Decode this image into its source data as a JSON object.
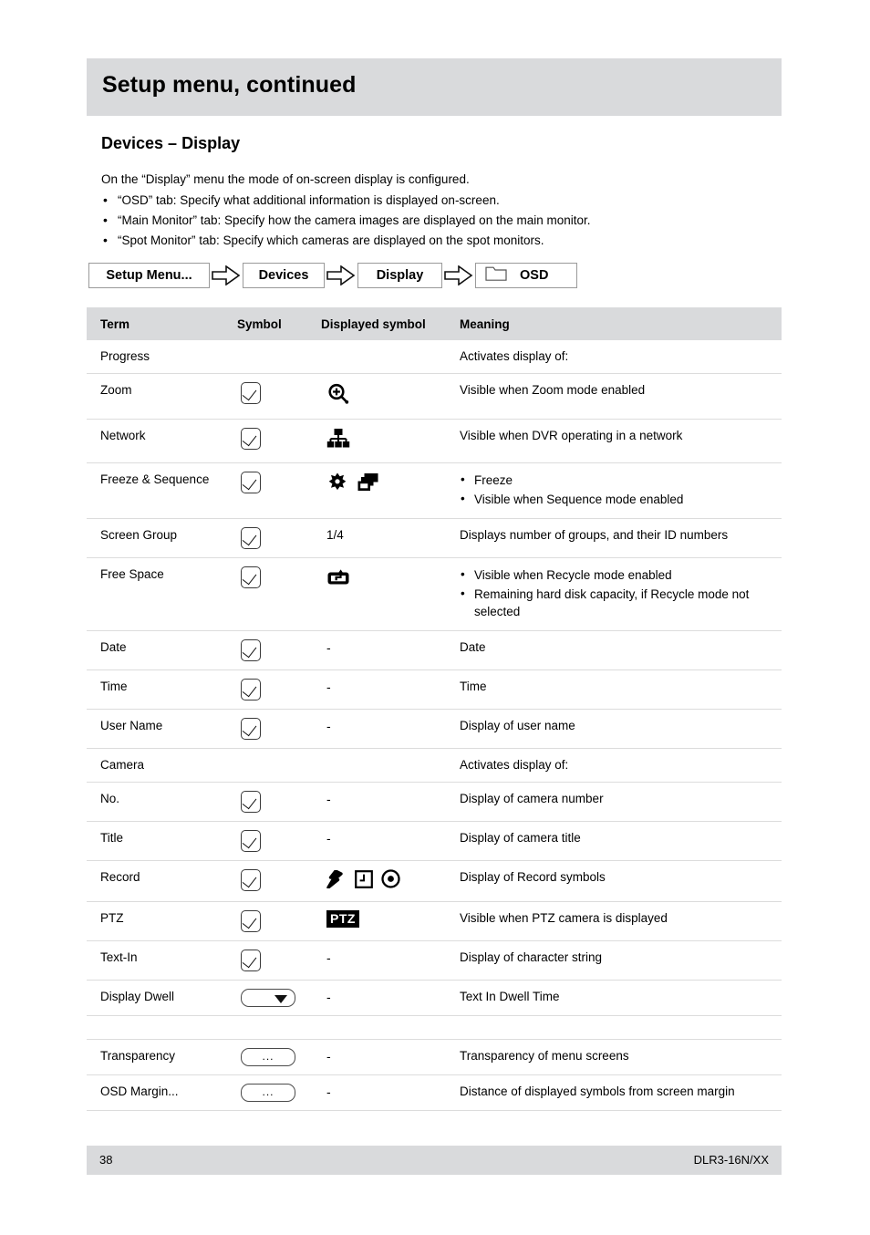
{
  "header": {
    "title": "Setup menu, continued"
  },
  "section": {
    "heading": "Devices – Display"
  },
  "intro": {
    "lead": "On the “Display” menu the mode of on-screen display is configured.",
    "bullets": [
      "“OSD” tab: Specify what additional information is displayed on-screen.",
      "“Main Monitor” tab: Specify how the camera images are displayed on the main monitor.",
      "“Spot Monitor” tab: Specify which cameras are displayed on the spot monitors."
    ]
  },
  "breadcrumb": {
    "items": [
      {
        "label": "Setup Menu...",
        "icon": ""
      },
      {
        "label": "Devices",
        "icon": ""
      },
      {
        "label": "Display",
        "icon": ""
      },
      {
        "label": "OSD",
        "icon": "folder-tab-icon"
      }
    ],
    "separator_icon": "right-arrow-icon"
  },
  "table": {
    "columns": [
      "Term",
      "Symbol",
      "Displayed symbol",
      "Meaning"
    ],
    "rows": [
      {
        "term": "Progress",
        "symbol": "",
        "displayed": "",
        "meaning": [
          "Activates display of:"
        ]
      },
      {
        "term": "Zoom",
        "symbol": "checkbox",
        "displayed": "zoom-magnifier-icon",
        "meaning": [
          "Visible when Zoom mode enabled"
        ]
      },
      {
        "term": "Network",
        "symbol": "checkbox",
        "displayed": "network-icon",
        "meaning": [
          "Visible when DVR operating in a network"
        ]
      },
      {
        "term": "Freeze & Sequence",
        "symbol": "checkbox",
        "displayed": "freeze-icon+sequence-icon",
        "meaning": [
          "Freeze",
          "Visible when Sequence mode enabled"
        ],
        "bulleted": true
      },
      {
        "term": "Screen Group",
        "symbol": "checkbox",
        "displayed": "1/4",
        "meaning": [
          "Displays number of groups, and their ID numbers"
        ]
      },
      {
        "term": "Free Space",
        "symbol": "checkbox",
        "displayed": "recycle-disk-icon",
        "meaning": [
          "Visible when Recycle mode enabled",
          "Remaining hard disk capacity, if Recycle mode not selected"
        ],
        "bulleted": true
      },
      {
        "term": "Date",
        "symbol": "checkbox",
        "displayed": "-",
        "meaning": [
          "Date"
        ]
      },
      {
        "term": "Time",
        "symbol": "checkbox",
        "displayed": "-",
        "meaning": [
          "Time"
        ]
      },
      {
        "term": "User Name",
        "symbol": "checkbox",
        "displayed": "-",
        "meaning": [
          "Display of user name"
        ]
      },
      {
        "term": "Camera",
        "symbol": "",
        "displayed": "",
        "meaning": [
          "Activates display of:"
        ]
      },
      {
        "term": "No.",
        "symbol": "checkbox",
        "displayed": "-",
        "meaning": [
          "Display of camera number"
        ]
      },
      {
        "term": "Title",
        "symbol": "checkbox",
        "displayed": "-",
        "meaning": [
          "Display of camera title"
        ]
      },
      {
        "term": "Record",
        "symbol": "checkbox",
        "displayed": "event-record-icon+schedule-record-icon+manual-record-icon",
        "meaning": [
          "Display of Record symbols"
        ]
      },
      {
        "term": "PTZ",
        "symbol": "checkbox",
        "displayed": "PTZ",
        "meaning": [
          "Visible when PTZ camera is displayed"
        ]
      },
      {
        "term": "Text-In",
        "symbol": "checkbox",
        "displayed": "-",
        "meaning": [
          "Display of character string"
        ]
      },
      {
        "term": "Display Dwell",
        "symbol": "dropdown",
        "displayed": "-",
        "meaning": [
          "Text In Dwell Time"
        ]
      },
      {
        "term": "",
        "symbol": "",
        "displayed": "",
        "meaning": [
          ""
        ],
        "empty": true
      },
      {
        "term": "Transparency",
        "symbol": "ellipsis-button",
        "displayed": "-",
        "meaning": [
          "Transparency of menu screens"
        ]
      },
      {
        "term": "OSD Margin...",
        "symbol": "ellipsis-button",
        "displayed": "-",
        "meaning": [
          "Distance of displayed symbols from screen margin"
        ]
      }
    ],
    "ellipsis_label": "...",
    "screen_group_value": "1/4",
    "ptz_value": "PTZ"
  },
  "footer": {
    "page_number": "38",
    "document_code": "DLR3-16N/XX"
  },
  "colors": {
    "band": "#d9dadc",
    "rule": "#dcdcdc",
    "text": "#000000"
  }
}
